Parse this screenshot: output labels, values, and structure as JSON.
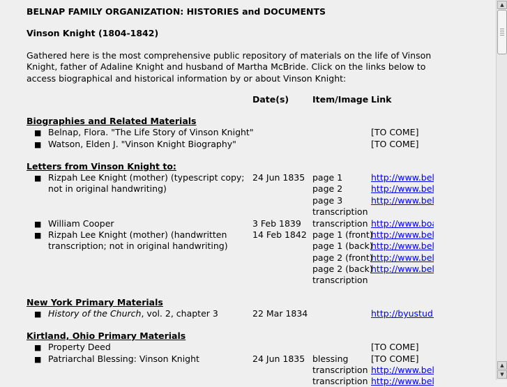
{
  "header": {
    "org_title": "BELNAP FAMILY ORGANIZATION: HISTORIES and DOCUMENTS",
    "person_title": "Vinson Knight (1804-1842)"
  },
  "intro": "Gathered here is the most comprehensive public repository of materials on the life of Vinson Knight, father of Adaline Knight and husband of Martha McBride.  Click on the links below to access biographical and historical information by or about Vinson Knight:",
  "columns": {
    "date": "Date(s)",
    "item": "Item/Image",
    "link": "Link"
  },
  "sections": {
    "bio": {
      "title": "Biographies and Related Materials",
      "rows": [
        {
          "desc": "Belnap, Flora. \"The Life Story of Vinson Knight\"",
          "link": "[TO COME]"
        },
        {
          "desc": "Watson, Elden J. \"Vinson Knight Biography\"",
          "link": "[TO COME]"
        }
      ]
    },
    "letters": {
      "title": "Letters from Vinson Knight to:",
      "rows": [
        {
          "desc": "Rizpah Lee Knight (mother) (typescript copy; not in original handwriting)",
          "date": "24 Jun 1835",
          "items": [
            "page 1",
            "page 2",
            "page 3",
            "transcription"
          ],
          "links": [
            "http://www.bel",
            "http://www.bel",
            "http://www.bel"
          ]
        },
        {
          "desc": "William Cooper",
          "date": "3 Feb 1839",
          "items": [
            "transcription"
          ],
          "links": [
            "http://www.boa"
          ]
        },
        {
          "desc": "Rizpah Lee Knight (mother) (handwritten transcription; not in original handwriting)",
          "date": "14 Feb 1842",
          "items": [
            "page 1 (front)",
            "page 1 (back)",
            "page 2 (front)",
            "page 2 (back)",
            "transcription"
          ],
          "links": [
            "http://www.bel",
            "http://www.bel",
            "http://www.bel",
            "http://www.bel"
          ]
        }
      ]
    },
    "ny": {
      "title": "New York Primary Materials",
      "rows": [
        {
          "desc_italic": "History of the Church",
          "desc_rest": ", vol. 2, chapter 3",
          "date": "22 Mar 1834",
          "link": "http://byustudi"
        }
      ]
    },
    "kirtland": {
      "title": "Kirtland, Ohio Primary Materials",
      "rows": [
        {
          "desc": "Property Deed",
          "link": "[TO COME]"
        },
        {
          "desc": "Patriarchal Blessing: Vinson Knight",
          "date": "24 Jun 1835",
          "items": [
            "blessing",
            "transcription",
            "transcription"
          ],
          "links": [
            "[TO COME]",
            "http://www.bel",
            "http://www.bel"
          ]
        }
      ]
    }
  },
  "bullet_glyph": "■",
  "scrollbar": {
    "up_arrow": "▲",
    "down_arrow": "▼"
  }
}
